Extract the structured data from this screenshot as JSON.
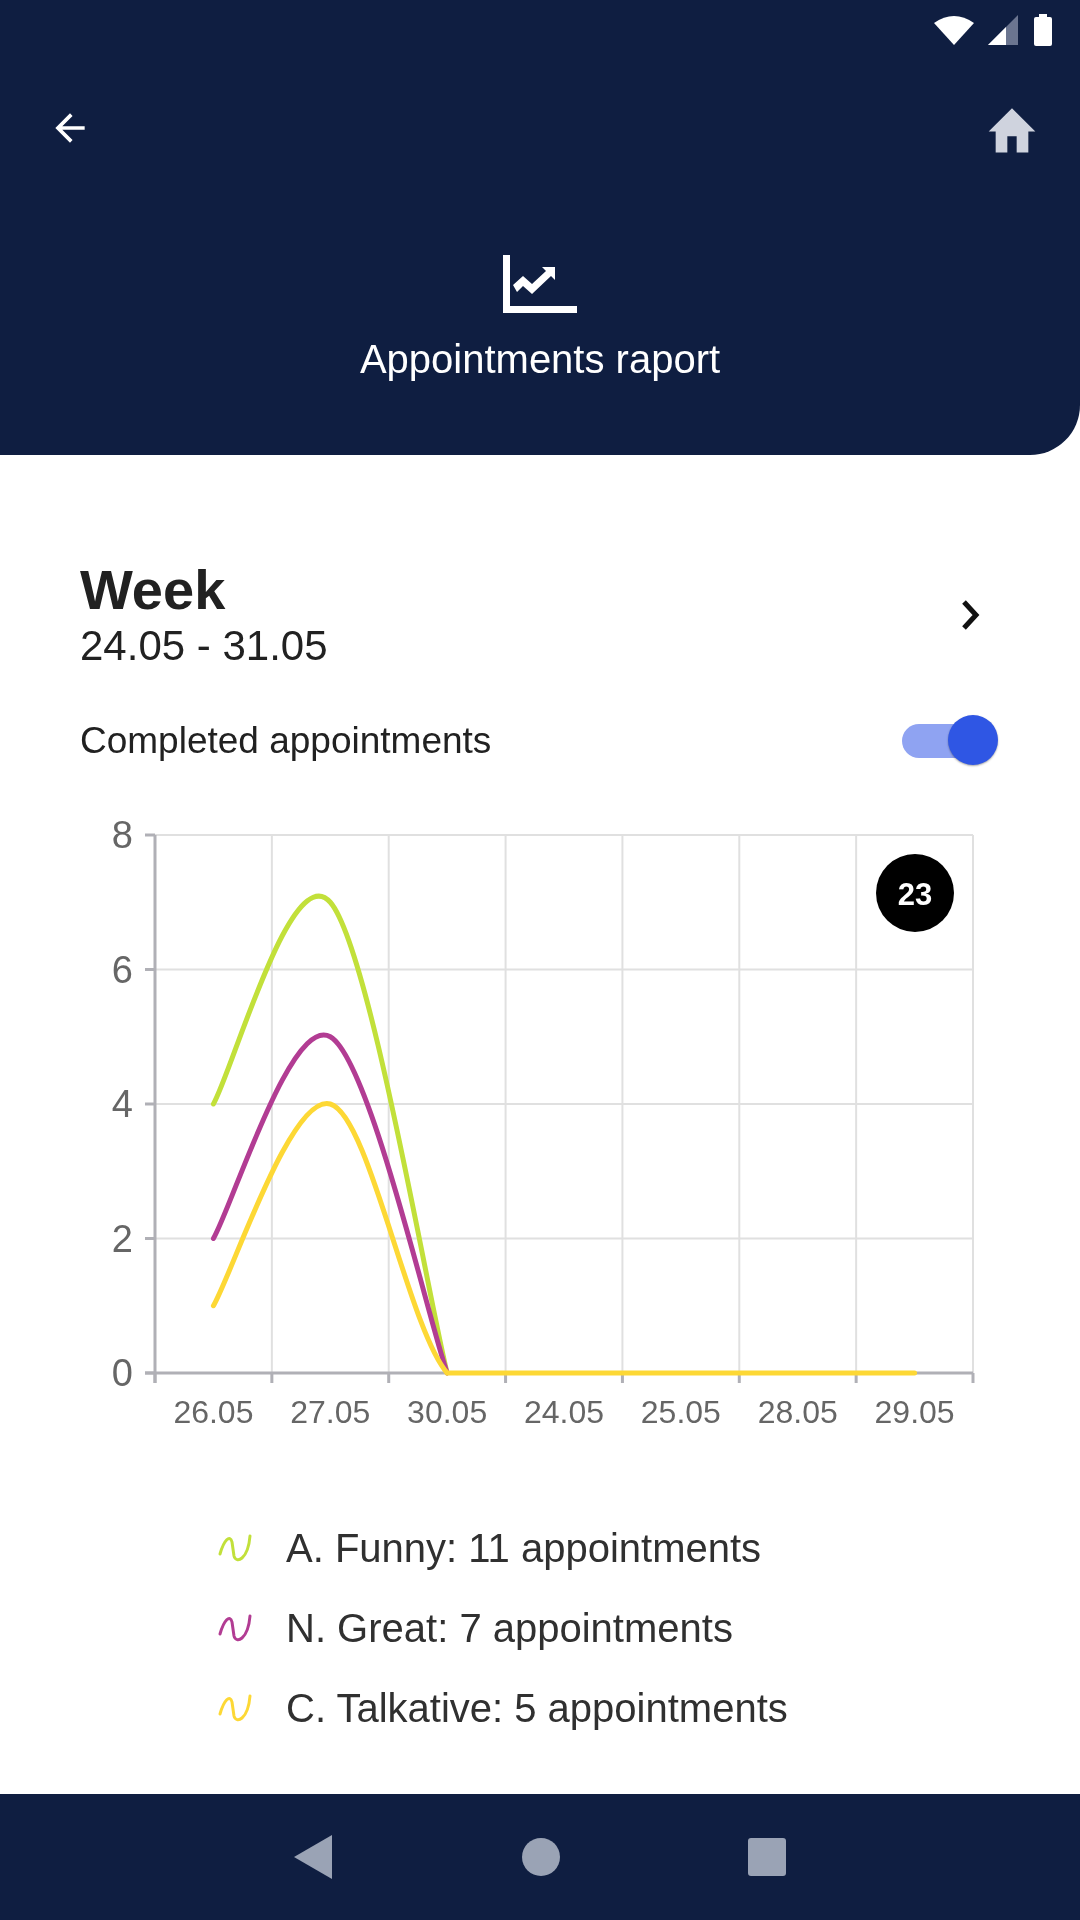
{
  "header": {
    "title": "Appointments raport"
  },
  "period": {
    "label": "Week",
    "range": "24.05 - 31.05"
  },
  "toggle": {
    "label": "Completed appointments",
    "on": true
  },
  "chart": {
    "badge": "23",
    "chart_data": {
      "type": "line",
      "categories": [
        "26.05",
        "27.05",
        "30.05",
        "24.05",
        "25.05",
        "28.05",
        "29.05"
      ],
      "ylim": [
        0,
        8
      ],
      "grid": true,
      "yticks": [
        0,
        2,
        4,
        6,
        8
      ],
      "series": [
        {
          "color": "#c2e03a",
          "values": [
            4,
            7,
            0,
            null,
            null,
            null,
            null
          ]
        },
        {
          "color": "#b23c93",
          "values": [
            2,
            5,
            0,
            null,
            null,
            null,
            null
          ]
        },
        {
          "color": "#fdd835",
          "values": [
            1,
            4,
            0,
            0,
            0,
            0,
            0
          ]
        }
      ]
    }
  },
  "legend": [
    {
      "text": "A. Funny: 11 appointments",
      "color": "#c2e03a"
    },
    {
      "text": "N. Great: 7 appointments",
      "color": "#b23c93"
    },
    {
      "text": "C. Talkative: 5 appointments",
      "color": "#fdd835"
    }
  ]
}
